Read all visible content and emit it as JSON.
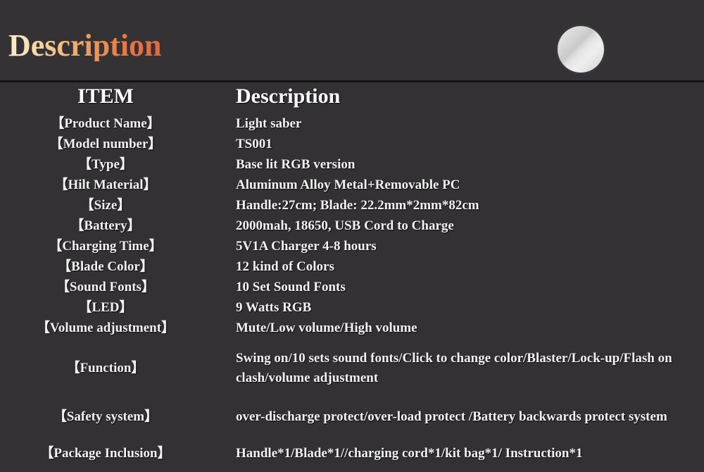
{
  "header": {
    "title": "Description",
    "moon_icon": "moon-circle-icon",
    "title_gradient_start": "#fbeccd",
    "title_gradient_end": "#e2673f",
    "background_color": "#333133"
  },
  "table": {
    "columns": {
      "item": "ITEM",
      "description": "Description"
    },
    "rows": [
      {
        "item": "【Product Name】",
        "value": "Light saber",
        "size": "item"
      },
      {
        "item": "【Model number】",
        "value": "TS001",
        "size": "item"
      },
      {
        "item": "【Type】",
        "value": "Base lit RGB version",
        "size": "item"
      },
      {
        "item": "【Hilt Material】",
        "value": "Aluminum Alloy Metal+Removable PC",
        "size": "item"
      },
      {
        "item": "【Size】",
        "value": "Handle:27cm; Blade: 22.2mm*2mm*82cm",
        "size": "item"
      },
      {
        "item": "【Battery】",
        "value": "2000mah, 18650, USB Cord to Charge",
        "size": "item"
      },
      {
        "item": "【Charging Time】",
        "value": "5V1A Charger  4-8 hours",
        "size": "item"
      },
      {
        "item": "【Blade Color】",
        "value": "12 kind of  Colors",
        "size": "item"
      },
      {
        "item": "【Sound Fonts】",
        "value": "10 Set Sound Fonts",
        "size": "item"
      },
      {
        "item": "【LED】",
        "value": "9 Watts RGB",
        "size": "item"
      },
      {
        "item": "【Volume adjustment】",
        "value": "Mute/Low volume/High volume",
        "size": "item"
      },
      {
        "item": "【Function】",
        "value": "Swing on/10 sets sound fonts/Click to change color/Blaster/Lock-up/Flash on clash/volume adjustment",
        "size": "func"
      },
      {
        "item": "【Safety system】",
        "value": "over-discharge protect/over-load protect /Battery backwards protect system",
        "size": "safety"
      },
      {
        "item": "【Package Inclusion】",
        "value": "Handle*1/Blade*1//charging cord*1/kit bag*1/ Instruction*1",
        "size": "package"
      }
    ]
  }
}
